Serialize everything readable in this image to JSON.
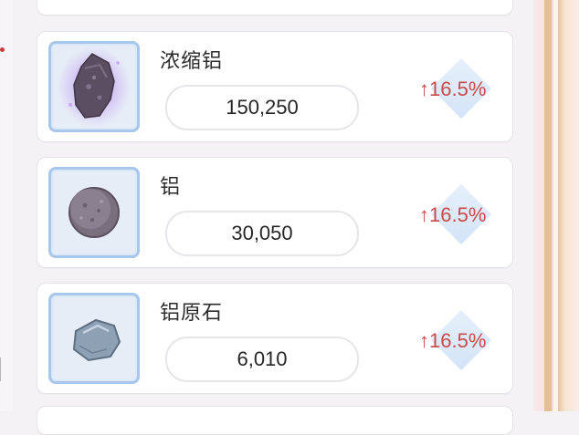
{
  "materials": [
    {
      "name": "浓缩铝",
      "quantity": "150,250",
      "change": "16.5%",
      "icon": "concentrated-aluminum-icon"
    },
    {
      "name": "铝",
      "quantity": "30,050",
      "change": "16.5%",
      "icon": "aluminum-icon"
    },
    {
      "name": "铝原石",
      "quantity": "6,010",
      "change": "16.5%",
      "icon": "aluminum-ore-icon"
    }
  ],
  "arrow_glyph": "↑",
  "colors": {
    "increase": "#c94a4a",
    "frame": "#a9c7ea"
  }
}
